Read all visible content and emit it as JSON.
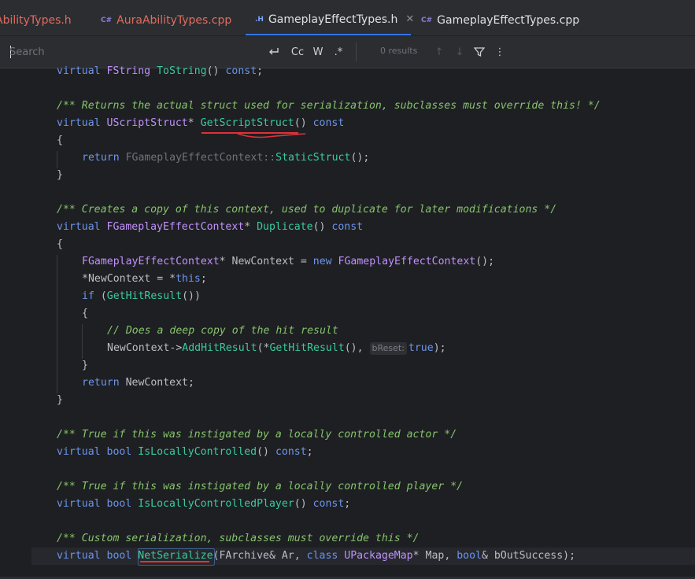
{
  "tabs": [
    {
      "label": "AbilityTypes.h",
      "icon": "",
      "color": "#e06c60",
      "active": false,
      "closable": false
    },
    {
      "label": "AuraAbilityTypes.cpp",
      "icon": "C#",
      "color": "#e06c60",
      "active": false,
      "closable": false
    },
    {
      "label": "GameplayEffectTypes.h",
      "icon": ".H",
      "color": "#dfe1e5",
      "active": true,
      "closable": true
    },
    {
      "label": "GameplayEffectTypes.cpp",
      "icon": "C#",
      "color": "#dfe1e5",
      "active": false,
      "closable": false
    }
  ],
  "find": {
    "placeholder": "Search",
    "value": "",
    "results": "0 results",
    "buttons": {
      "match_case": "Cc",
      "words": "W",
      "regex": ".*"
    }
  },
  "code": {
    "l1": {
      "kw": "virtual",
      "type": "FString",
      "fn": "ToString",
      "rest": "()",
      "kw2": "const",
      "end": ";"
    },
    "l3": "/** Returns the actual struct used for serialization, subclasses must override this! */",
    "l4": {
      "kw": "virtual",
      "type": "UScriptStruct",
      "star": "*",
      "fn": "GetScriptStruct",
      "rest": "()",
      "kw2": "const"
    },
    "l5": "{",
    "l6": {
      "kw": "return",
      "scope": "FGameplayEffectContext::",
      "fn": "StaticStruct",
      "rest": "();"
    },
    "l7": "}",
    "l9": "/** Creates a copy of this context, used to duplicate for later modifications */",
    "l10": {
      "kw": "virtual",
      "type": "FGameplayEffectContext",
      "star": "*",
      "fn": "Duplicate",
      "rest": "()",
      "kw2": "const"
    },
    "l11": "{",
    "l12": {
      "type": "FGameplayEffectContext",
      "mid": "* NewContext = ",
      "kw": "new",
      "type2": "FGameplayEffectContext",
      "rest": "();"
    },
    "l13": {
      "a": "*NewContext = *",
      "kw": "this",
      "end": ";"
    },
    "l14": {
      "kw": "if",
      "a": " (",
      "fn": "GetHitResult",
      "rest": "())"
    },
    "l15": "{",
    "l16": "// Does a deep copy of the hit result",
    "l17": {
      "a": "NewContext->",
      "fn": "AddHitResult",
      "b": "(*",
      "fn2": "GetHitResult",
      "c": "(), ",
      "hint": "bReset:",
      "kw": "true",
      "end": ");"
    },
    "l18": "}",
    "l19": {
      "kw": "return",
      "rest": " NewContext;"
    },
    "l20": "}",
    "l22": "/** True if this was instigated by a locally controlled actor */",
    "l23": {
      "kw": "virtual",
      "kw2": "bool",
      "fn": "IsLocallyControlled",
      "rest": "()",
      "kw3": "const",
      "end": ";"
    },
    "l25": "/** True if this was instigated by a locally controlled player */",
    "l26": {
      "kw": "virtual",
      "kw2": "bool",
      "fn": "IsLocallyControlledPlayer",
      "rest": "()",
      "kw3": "const",
      "end": ";"
    },
    "l28": "/** Custom serialization, subclasses must override this */",
    "l29": {
      "kw": "virtual",
      "kw2": "bool",
      "fn": "NetSerialize",
      "a": "(FArchive& Ar, ",
      "kw3": "class",
      "type": "UPackageMap",
      "b": "* Map, ",
      "kw4": "bool",
      "c": "& bOutSuccess);"
    }
  }
}
